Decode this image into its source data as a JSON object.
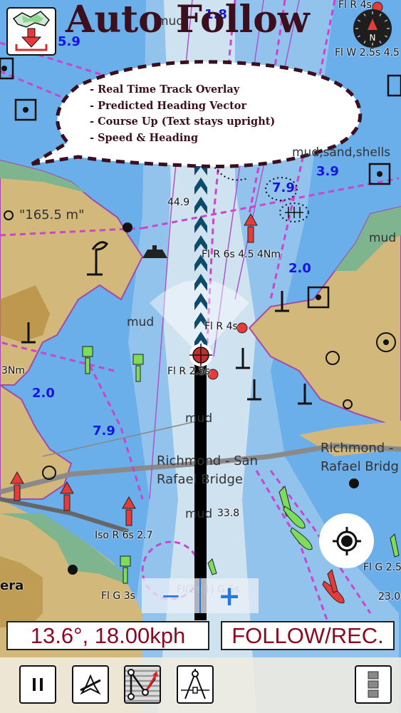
{
  "app": {
    "title": "Auto Follow",
    "callout": {
      "items": [
        "- Real Time Track Overlay",
        "- Predicted Heading Vector",
        "- Course Up (Text stays upright)",
        "- Speed & Heading"
      ]
    }
  },
  "top_controls": {
    "download_icon": "map-download-icon",
    "compass_icon": "compass-icon",
    "compass_letter": "N"
  },
  "map_labels": {
    "depths": [
      "5.9",
      "3.9",
      "7.9",
      "2.0",
      "2.0",
      "7.9",
      "1.8"
    ],
    "soundings": [
      "44.9",
      "33.8",
      "23.0"
    ],
    "lights": [
      "Fl W 2.5s 4.5",
      "Fl R 6s 4.5 4Nm",
      "Fl R 4s",
      "Fl R 2.5s",
      "3Nm",
      "Iso R 6s 2.7",
      "Fl G 3s",
      "Fl(2+1) G 6s",
      "Fl G 2.5",
      "Fl R 4s"
    ],
    "seabed": [
      "mud",
      "mud,sand,shells",
      "mud",
      "mud",
      "mud",
      "mud"
    ],
    "places": [
      "\"165.5 m\"",
      "Richmond - San",
      "Rafael Bridge",
      "Richmond -",
      "Rafael Bridg",
      "era"
    ]
  },
  "status": {
    "heading_speed": "13.6°, 18.00kph",
    "mode": "FOLLOW/REC."
  },
  "zoom_controls": {
    "zoom_out": "−",
    "zoom_in": "+"
  },
  "toolbar": {
    "buttons": [
      {
        "name": "pause",
        "icon": "pause-icon"
      },
      {
        "name": "route-off",
        "icon": "route-off-icon"
      },
      {
        "name": "track",
        "icon": "track-icon"
      },
      {
        "name": "measure",
        "icon": "dividers-icon"
      },
      {
        "name": "more",
        "icon": "more-icon"
      }
    ]
  },
  "colors": {
    "title": "#3c0f1e",
    "status_text": "#8a0a22",
    "water_deep": "#6aaeea",
    "water_shallow": "#b9d7ee",
    "land": "#d2b87a",
    "marsh": "#7fb58e",
    "route_magenta": "#cc44cc",
    "depth_blue": "#1515e0"
  }
}
